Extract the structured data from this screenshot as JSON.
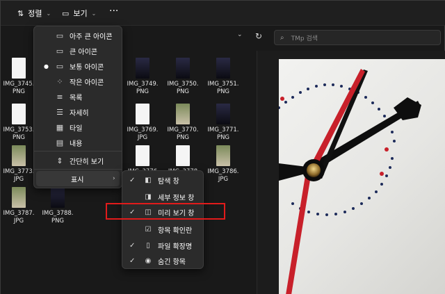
{
  "toolbar": {
    "sort_label": "정렬",
    "view_label": "보기",
    "more_label": "···"
  },
  "search": {
    "placeholder": "TMp 검색"
  },
  "view_menu": {
    "items": [
      {
        "label": "아주 큰 아이콘",
        "icon": "monitor-icon",
        "selected": false
      },
      {
        "label": "큰 아이콘",
        "icon": "monitor-icon",
        "selected": false
      },
      {
        "label": "보통 아이콘",
        "icon": "monitor-icon",
        "selected": true
      },
      {
        "label": "작은 아이콘",
        "icon": "small-icons-icon",
        "selected": false
      },
      {
        "label": "목록",
        "icon": "list-icon",
        "selected": false
      },
      {
        "label": "자세히",
        "icon": "details-icon",
        "selected": false
      },
      {
        "label": "타일",
        "icon": "tiles-icon",
        "selected": false
      },
      {
        "label": "내용",
        "icon": "content-icon",
        "selected": false
      },
      {
        "label": "간단히 보기",
        "icon": "compact-icon",
        "selected": false
      },
      {
        "label": "표시",
        "icon": "",
        "has_submenu": true
      }
    ]
  },
  "show_submenu": {
    "items": [
      {
        "label": "탐색 창",
        "checked": true,
        "icon": "nav-pane-icon"
      },
      {
        "label": "세부 정보 창",
        "checked": false,
        "icon": "details-pane-icon"
      },
      {
        "label": "미리 보기 창",
        "checked": true,
        "icon": "preview-pane-icon"
      },
      {
        "label": "항목 확인란",
        "checked": false,
        "icon": "checkbox-icon"
      },
      {
        "label": "파일 확장명",
        "checked": true,
        "icon": "file-icon"
      },
      {
        "label": "숨긴 항목",
        "checked": true,
        "icon": "eye-icon"
      }
    ]
  },
  "files": [
    {
      "name": "IMG_3745.",
      "ext": "PNG",
      "thumb": "doc"
    },
    {
      "name": "IMG_3749.",
      "ext": "PNG",
      "thumb": "phone"
    },
    {
      "name": "IMG_3750.",
      "ext": "PNG",
      "thumb": "phone"
    },
    {
      "name": "IMG_3751.",
      "ext": "PNG",
      "thumb": "phone"
    },
    {
      "name": "IMG_3753.",
      "ext": "PNG",
      "thumb": "doc"
    },
    {
      "name": "IMG_3769.",
      "ext": "JPG",
      "thumb": "doc"
    },
    {
      "name": "IMG_3770.",
      "ext": "PNG",
      "thumb": "pic"
    },
    {
      "name": "IMG_3771.",
      "ext": "PNG",
      "thumb": "phone"
    },
    {
      "name": "IMG_3773.",
      "ext": "JPG",
      "thumb": "pic"
    },
    {
      "name": "IMG_3776",
      "ext": "",
      "thumb": "doc"
    },
    {
      "name": "IMG_3778",
      "ext": "",
      "thumb": "doc"
    },
    {
      "name": "IMG_3786.",
      "ext": "JPG",
      "thumb": "pic"
    },
    {
      "name": "IMG_3787.",
      "ext": "JPG",
      "thumb": "pic"
    },
    {
      "name": "IMG_3788.",
      "ext": "PNG",
      "thumb": "phone"
    }
  ],
  "colors": {
    "highlight_box": "#e21b1b",
    "clock_hand": "#c8202a"
  }
}
